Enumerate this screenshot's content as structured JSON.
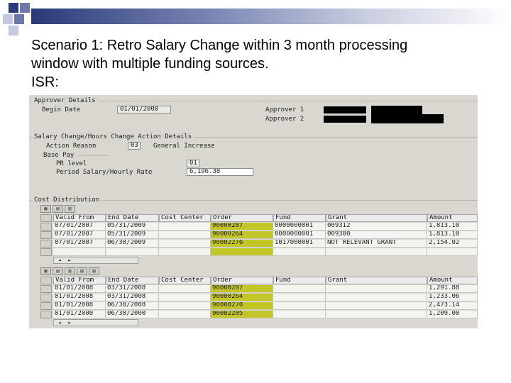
{
  "slide": {
    "heading_lines": [
      "Scenario 1: Retro Salary Change within 3 month processing",
      "window with multiple funding sources.",
      "ISR:"
    ]
  },
  "approver": {
    "section_title": "Approver Details",
    "begin_date_label": "Begin Date",
    "begin_date_value": "01/01/2000",
    "approver1_label": "Approver 1",
    "approver2_label": "Approver 2"
  },
  "salary": {
    "section_title": "Salary Change/Hours Change Action Details",
    "action_reason_label": "Action Reason",
    "action_reason_code": "03",
    "action_reason_text": "General Increase",
    "base_pay_label": "Base Pay",
    "pr_level_label": "PR level",
    "pr_level_value": "01",
    "period_salary_label": "Period Salary/Hourly Rate",
    "period_salary_value": "6,196.38"
  },
  "cost": {
    "section_title": "Cost Distribution",
    "columns": [
      "Valid From",
      "End Date",
      "Cost Center",
      "Order",
      "Fund",
      "Grant",
      "Amount"
    ],
    "table1_rows": [
      [
        "07/01/2007",
        "05/31/2009",
        "",
        "90000287",
        "0000000001",
        "009312",
        "1,813.10"
      ],
      [
        "07/01/2007",
        "05/31/2009",
        "",
        "90000264",
        "0000000001",
        "009300",
        "1,813.10"
      ],
      [
        "07/01/2007",
        "06/30/2009",
        "",
        "90002276",
        "1017000001",
        "NOT RELEVANT GRANT",
        "2,154.02"
      ],
      [
        "",
        "",
        "",
        "",
        "",
        "",
        ""
      ]
    ],
    "table2_rows": [
      [
        "01/01/2008",
        "03/31/2008",
        "",
        "90000287",
        "",
        "",
        "1,291.88"
      ],
      [
        "01/01/2008",
        "03/31/2008",
        "",
        "90000264",
        "",
        "",
        "1,233.06"
      ],
      [
        "01/01/2008",
        "06/30/2008",
        "",
        "90000270",
        "",
        "",
        "2,473.14"
      ],
      [
        "01/01/2000",
        "06/30/2000",
        "",
        "90002205",
        "",
        "",
        "1,209.00"
      ]
    ]
  },
  "colors": {
    "highlight": "#c3c629",
    "sap_background": "#d8d8d1"
  }
}
